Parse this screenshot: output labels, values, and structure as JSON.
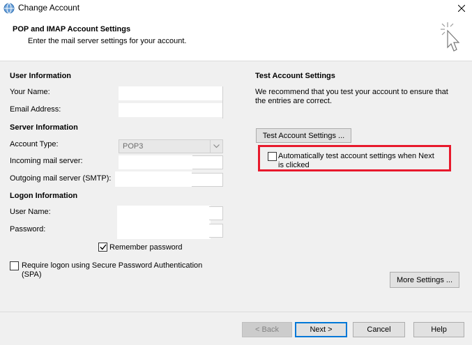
{
  "window": {
    "title": "Change Account",
    "close_label": "✕"
  },
  "header": {
    "title": "POP and IMAP Account Settings",
    "subtitle": "Enter the mail server settings for your account."
  },
  "user_info": {
    "heading": "User Information",
    "your_name_label": "Your Name:",
    "email_label": "Email Address:",
    "your_name_value": "",
    "email_value": ""
  },
  "server_info": {
    "heading": "Server Information",
    "account_type_label": "Account Type:",
    "account_type_value": "POP3",
    "incoming_label": "Incoming mail server:",
    "outgoing_label": "Outgoing mail server (SMTP):",
    "incoming_value": "",
    "outgoing_value": ""
  },
  "logon_info": {
    "heading": "Logon Information",
    "username_label": "User Name:",
    "password_label": "Password:",
    "remember_label": "Remember password",
    "remember_checked": true,
    "spa_label_line1": "Require logon using Secure Password Authentication",
    "spa_label_line2": "(SPA)",
    "spa_checked": false
  },
  "test_settings": {
    "heading": "Test Account Settings",
    "desc_line1": "We recommend that you test your account to ensure that",
    "desc_line2": "the entries are correct.",
    "test_button": "Test Account Settings ...",
    "auto_test_line1": "Automatically test account settings when Next",
    "auto_test_line2": "is clicked",
    "auto_test_checked": false
  },
  "more_settings_button": "More Settings ...",
  "footer": {
    "back": "< Back",
    "next": "Next >",
    "cancel": "Cancel",
    "help": "Help"
  },
  "colors": {
    "highlight": "#e8192c",
    "accent": "#0078d7"
  }
}
